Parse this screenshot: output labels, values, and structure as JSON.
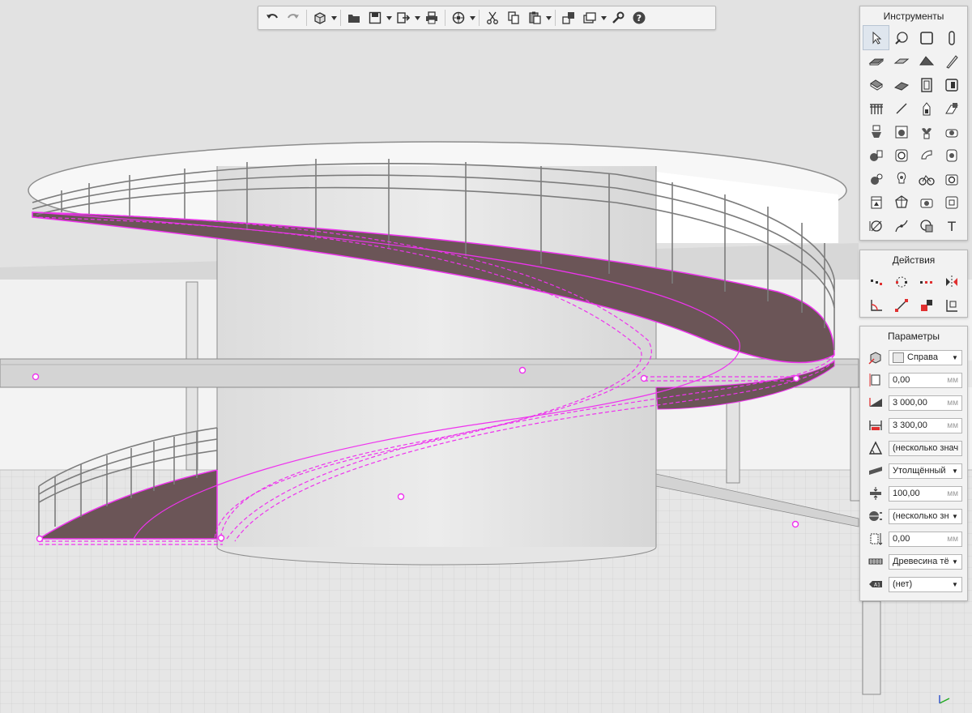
{
  "toolbar": {
    "buttons": [
      "undo-icon",
      "redo-icon",
      "view-3d-icon",
      "open-folder-icon",
      "save-icon",
      "export-icon",
      "print-icon",
      "render-icon",
      "cut-icon",
      "copy-icon",
      "paste-icon",
      "layers-icon",
      "views-icon",
      "settings-wrench-icon",
      "help-icon"
    ]
  },
  "tools_panel": {
    "title": "Инструменты",
    "text_tool_glyph": "T"
  },
  "actions_panel": {
    "title": "Действия"
  },
  "params_panel": {
    "title": "Параметры",
    "side": "Справа",
    "offset": "0,00",
    "height": "3 000,00",
    "width": "3 300,00",
    "slope": "(несколько знач",
    "structure": "Утолщённый",
    "thickness": "100,00",
    "profile": "(несколько зн",
    "elevation": "0,00",
    "material": "Древесина тё",
    "label": "(нет)",
    "unit": "мм",
    "label_icon_text": "A1"
  },
  "colors": {
    "selection": "#ee33ee",
    "ramp_surface": "#6b5557",
    "toolbar_bg": "#f3f3f3",
    "panel_bg": "#f2f2f2"
  }
}
